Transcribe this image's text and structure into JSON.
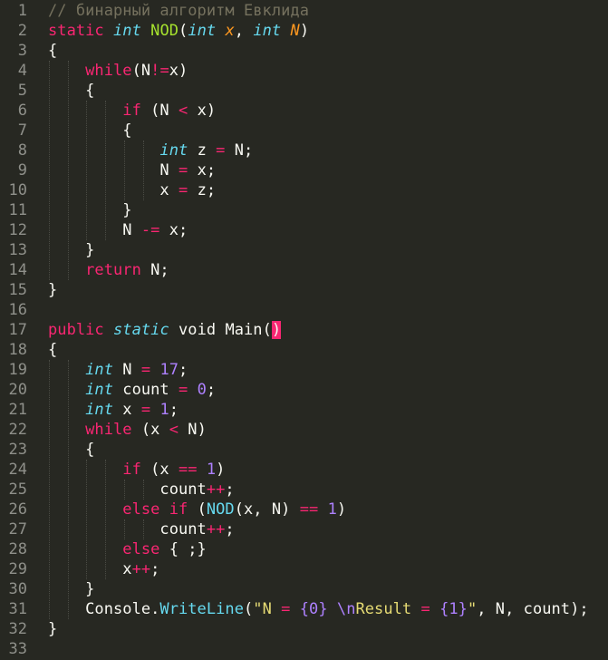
{
  "editor": {
    "theme_colors": {
      "background": "#272822",
      "line_number": "#8f908a",
      "keyword": "#f92672",
      "type": "#66d9ef",
      "function": "#a6e22e",
      "parameter": "#fd971f",
      "number": "#ae81ff",
      "string": "#e6db74",
      "comment": "#75715e",
      "plain": "#f8f8f2"
    },
    "lines": [
      {
        "n": "1",
        "tokens": [
          [
            "comment",
            "// бинарный алгоритм Евклида"
          ]
        ]
      },
      {
        "n": "2",
        "tokens": [
          [
            "keyword",
            "static"
          ],
          [
            "plain",
            " "
          ],
          [
            "type",
            "int"
          ],
          [
            "plain",
            " "
          ],
          [
            "func",
            "NOD"
          ],
          [
            "plain",
            "("
          ],
          [
            "type",
            "int"
          ],
          [
            "plain",
            " "
          ],
          [
            "param",
            "x"
          ],
          [
            "plain",
            ", "
          ],
          [
            "type",
            "int"
          ],
          [
            "plain",
            " "
          ],
          [
            "param",
            "N"
          ],
          [
            "plain",
            ")"
          ]
        ]
      },
      {
        "n": "3",
        "tokens": [
          [
            "plain",
            "{"
          ]
        ]
      },
      {
        "n": "4",
        "tokens": [
          [
            "plain",
            "    "
          ],
          [
            "keyword",
            "while"
          ],
          [
            "plain",
            "(N"
          ],
          [
            "op",
            "!="
          ],
          [
            "plain",
            "x)"
          ]
        ]
      },
      {
        "n": "5",
        "tokens": [
          [
            "plain",
            "    {"
          ]
        ]
      },
      {
        "n": "6",
        "tokens": [
          [
            "plain",
            "        "
          ],
          [
            "keyword",
            "if"
          ],
          [
            "plain",
            " (N "
          ],
          [
            "op",
            "<"
          ],
          [
            "plain",
            " x)"
          ]
        ]
      },
      {
        "n": "7",
        "tokens": [
          [
            "plain",
            "        {"
          ]
        ]
      },
      {
        "n": "8",
        "tokens": [
          [
            "plain",
            "            "
          ],
          [
            "type",
            "int"
          ],
          [
            "plain",
            " z "
          ],
          [
            "op",
            "="
          ],
          [
            "plain",
            " N;"
          ]
        ]
      },
      {
        "n": "9",
        "tokens": [
          [
            "plain",
            "            N "
          ],
          [
            "op",
            "="
          ],
          [
            "plain",
            " x;"
          ]
        ]
      },
      {
        "n": "10",
        "tokens": [
          [
            "plain",
            "            x "
          ],
          [
            "op",
            "="
          ],
          [
            "plain",
            " z;"
          ]
        ]
      },
      {
        "n": "11",
        "tokens": [
          [
            "plain",
            "        }"
          ]
        ]
      },
      {
        "n": "12",
        "tokens": [
          [
            "plain",
            "        N "
          ],
          [
            "op",
            "-="
          ],
          [
            "plain",
            " x;"
          ]
        ]
      },
      {
        "n": "13",
        "tokens": [
          [
            "plain",
            "    }"
          ]
        ]
      },
      {
        "n": "14",
        "tokens": [
          [
            "plain",
            "    "
          ],
          [
            "keyword",
            "return"
          ],
          [
            "plain",
            " N;"
          ]
        ]
      },
      {
        "n": "15",
        "tokens": [
          [
            "plain",
            "}"
          ]
        ]
      },
      {
        "n": "16",
        "tokens": []
      },
      {
        "n": "17",
        "tokens": [
          [
            "keyword",
            "public"
          ],
          [
            "plain",
            " "
          ],
          [
            "type",
            "static"
          ],
          [
            "plain",
            " void Main("
          ],
          [
            "bracket-hl",
            ")"
          ]
        ]
      },
      {
        "n": "18",
        "tokens": [
          [
            "plain",
            "{"
          ]
        ]
      },
      {
        "n": "19",
        "tokens": [
          [
            "plain",
            "    "
          ],
          [
            "type",
            "int"
          ],
          [
            "plain",
            " N "
          ],
          [
            "op",
            "="
          ],
          [
            "plain",
            " "
          ],
          [
            "num",
            "17"
          ],
          [
            "plain",
            ";"
          ]
        ]
      },
      {
        "n": "20",
        "tokens": [
          [
            "plain",
            "    "
          ],
          [
            "type",
            "int"
          ],
          [
            "plain",
            " count "
          ],
          [
            "op",
            "="
          ],
          [
            "plain",
            " "
          ],
          [
            "num",
            "0"
          ],
          [
            "plain",
            ";"
          ]
        ]
      },
      {
        "n": "21",
        "tokens": [
          [
            "plain",
            "    "
          ],
          [
            "type",
            "int"
          ],
          [
            "plain",
            " x "
          ],
          [
            "op",
            "="
          ],
          [
            "plain",
            " "
          ],
          [
            "num",
            "1"
          ],
          [
            "plain",
            ";"
          ]
        ]
      },
      {
        "n": "22",
        "tokens": [
          [
            "plain",
            "    "
          ],
          [
            "keyword",
            "while"
          ],
          [
            "plain",
            " (x "
          ],
          [
            "op",
            "<"
          ],
          [
            "plain",
            " N)"
          ]
        ]
      },
      {
        "n": "23",
        "tokens": [
          [
            "plain",
            "    {"
          ]
        ]
      },
      {
        "n": "24",
        "tokens": [
          [
            "plain",
            "        "
          ],
          [
            "keyword",
            "if"
          ],
          [
            "plain",
            " (x "
          ],
          [
            "op",
            "=="
          ],
          [
            "plain",
            " "
          ],
          [
            "num",
            "1"
          ],
          [
            "plain",
            ")"
          ]
        ]
      },
      {
        "n": "25",
        "tokens": [
          [
            "plain",
            "            count"
          ],
          [
            "op",
            "++"
          ],
          [
            "plain",
            ";"
          ]
        ]
      },
      {
        "n": "26",
        "tokens": [
          [
            "plain",
            "        "
          ],
          [
            "keyword",
            "else if"
          ],
          [
            "plain",
            " ("
          ],
          [
            "call",
            "NOD"
          ],
          [
            "plain",
            "(x, N) "
          ],
          [
            "op",
            "=="
          ],
          [
            "plain",
            " "
          ],
          [
            "num",
            "1"
          ],
          [
            "plain",
            ")"
          ]
        ]
      },
      {
        "n": "27",
        "tokens": [
          [
            "plain",
            "            count"
          ],
          [
            "op",
            "++"
          ],
          [
            "plain",
            ";"
          ]
        ]
      },
      {
        "n": "28",
        "tokens": [
          [
            "plain",
            "        "
          ],
          [
            "keyword",
            "else"
          ],
          [
            "plain",
            " { ;}"
          ]
        ]
      },
      {
        "n": "29",
        "tokens": [
          [
            "plain",
            "        x"
          ],
          [
            "op",
            "++"
          ],
          [
            "plain",
            ";"
          ]
        ]
      },
      {
        "n": "30",
        "tokens": [
          [
            "plain",
            "    }"
          ]
        ]
      },
      {
        "n": "31",
        "tokens": [
          [
            "plain",
            "    Console."
          ],
          [
            "call",
            "WriteLine"
          ],
          [
            "plain",
            "("
          ],
          [
            "string",
            "\"N "
          ],
          [
            "op",
            "="
          ],
          [
            "string",
            " "
          ],
          [
            "num",
            "{0}"
          ],
          [
            "string",
            " "
          ],
          [
            "num",
            "\\n"
          ],
          [
            "string",
            "Result "
          ],
          [
            "op",
            "="
          ],
          [
            "string",
            " "
          ],
          [
            "num",
            "{1}"
          ],
          [
            "string",
            "\""
          ],
          [
            "plain",
            ", N, count);"
          ]
        ]
      },
      {
        "n": "32",
        "tokens": [
          [
            "plain",
            "}"
          ]
        ]
      },
      {
        "n": "33",
        "tokens": []
      }
    ]
  }
}
